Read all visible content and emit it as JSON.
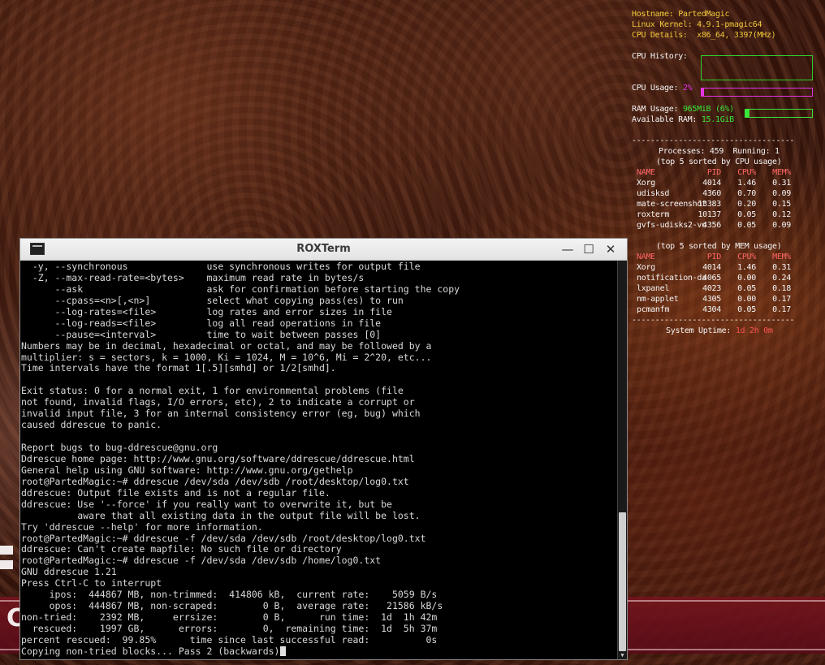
{
  "desktop": {
    "bottom_glyph": "C"
  },
  "conky": {
    "hostname_label": "Hostname:",
    "hostname": "PartedMagic",
    "kernel_label": "Linux Kernel:",
    "kernel": "4.9.1-pmagic64",
    "cpu_details_label": "CPU Details:",
    "cpu_details": "x86_64, 3397(MHz)",
    "cpu_history_label": "CPU History:",
    "cpu_usage_label": "CPU Usage:",
    "cpu_usage": "2%",
    "cpu_usage_fraction": 0.02,
    "ram_usage_label": "RAM Usage:",
    "ram_usage": "965MiB (6%)",
    "ram_usage_fraction": 0.06,
    "available_ram_label": "Available RAM:",
    "available_ram": "15.1GiB",
    "separator": "-----------------------------------",
    "processes_line": "Processes: 459  Running: 1",
    "top_cpu_heading": "(top 5 sorted by CPU usage)",
    "top_mem_heading": "(top 5 sorted by MEM usage)",
    "headers": {
      "name": "NAME",
      "pid": "PID",
      "cpu": "CPU%",
      "mem": "MEM%"
    },
    "top_cpu": [
      {
        "name": "Xorg",
        "pid": "4014",
        "cpu": "1.46",
        "mem": "0.31"
      },
      {
        "name": "udisksd",
        "pid": "4360",
        "cpu": "0.70",
        "mem": "0.09"
      },
      {
        "name": "mate-screenshot",
        "pid": "13383",
        "cpu": "0.20",
        "mem": "0.15"
      },
      {
        "name": "roxterm",
        "pid": "10137",
        "cpu": "0.05",
        "mem": "0.12"
      },
      {
        "name": "gvfs-udisks2-vo",
        "pid": "4356",
        "cpu": "0.05",
        "mem": "0.09"
      }
    ],
    "top_mem": [
      {
        "name": "Xorg",
        "pid": "4014",
        "cpu": "1.46",
        "mem": "0.31"
      },
      {
        "name": "notification-da",
        "pid": "4065",
        "cpu": "0.00",
        "mem": "0.24"
      },
      {
        "name": "lxpanel",
        "pid": "4023",
        "cpu": "0.05",
        "mem": "0.18"
      },
      {
        "name": "nm-applet",
        "pid": "4305",
        "cpu": "0.00",
        "mem": "0.17"
      },
      {
        "name": "pcmanfm",
        "pid": "4304",
        "cpu": "0.05",
        "mem": "0.17"
      }
    ],
    "uptime_label": "System Uptime:",
    "uptime": "1d 2h 0m",
    "colors": {
      "label": "#f0c83a",
      "cpu_bar": "#e436e4",
      "ram_bar": "#39e639",
      "header": "#ff6666"
    }
  },
  "window": {
    "title": "ROXTerm",
    "minimize_glyph": "—",
    "maximize_glyph": "☐",
    "close_glyph": "✕"
  },
  "terminal": {
    "lines": [
      "  -y, --synchronous              use synchronous writes for output file",
      "  -Z, --max-read-rate=<bytes>    maximum read rate in bytes/s",
      "      --ask                      ask for confirmation before starting the copy",
      "      --cpass=<n>[,<n>]          select what copying pass(es) to run",
      "      --log-rates=<file>         log rates and error sizes in file",
      "      --log-reads=<file>         log all read operations in file",
      "      --pause=<interval>         time to wait between passes [0]",
      "Numbers may be in decimal, hexadecimal or octal, and may be followed by a",
      "multiplier: s = sectors, k = 1000, Ki = 1024, M = 10^6, Mi = 2^20, etc...",
      "Time intervals have the format 1[.5][smhd] or 1/2[smhd].",
      "",
      "Exit status: 0 for a normal exit, 1 for environmental problems (file",
      "not found, invalid flags, I/O errors, etc), 2 to indicate a corrupt or",
      "invalid input file, 3 for an internal consistency error (eg, bug) which",
      "caused ddrescue to panic.",
      "",
      "Report bugs to bug-ddrescue@gnu.org",
      "Ddrescue home page: http://www.gnu.org/software/ddrescue/ddrescue.html",
      "General help using GNU software: http://www.gnu.org/gethelp",
      "root@PartedMagic:~# ddrescue /dev/sda /dev/sdb /root/desktop/log0.txt",
      "ddrescue: Output file exists and is not a regular file.",
      "ddrescue: Use '--force' if you really want to overwrite it, but be",
      "          aware that all existing data in the output file will be lost.",
      "Try 'ddrescue --help' for more information.",
      "root@PartedMagic:~# ddrescue -f /dev/sda /dev/sdb /root/desktop/log0.txt",
      "ddrescue: Can't create mapfile: No such file or directory",
      "root@PartedMagic:~# ddrescue -f /dev/sda /dev/sdb /home/log0.txt",
      "GNU ddrescue 1.21",
      "Press Ctrl-C to interrupt",
      "     ipos:  444867 MB, non-trimmed:  414806 kB,  current rate:    5059 B/s",
      "     opos:  444867 MB, non-scraped:        0 B,  average rate:   21586 kB/s",
      "non-tried:    2392 MB,     errsize:        0 B,      run time:  1d  1h 42m",
      "  rescued:    1997 GB,      errors:        0,  remaining time:  1d  5h 37m",
      "percent rescued:  99.85%      time since last successful read:          0s"
    ],
    "last_line": "Copying non-tried blocks... Pass 2 (backwards)"
  }
}
